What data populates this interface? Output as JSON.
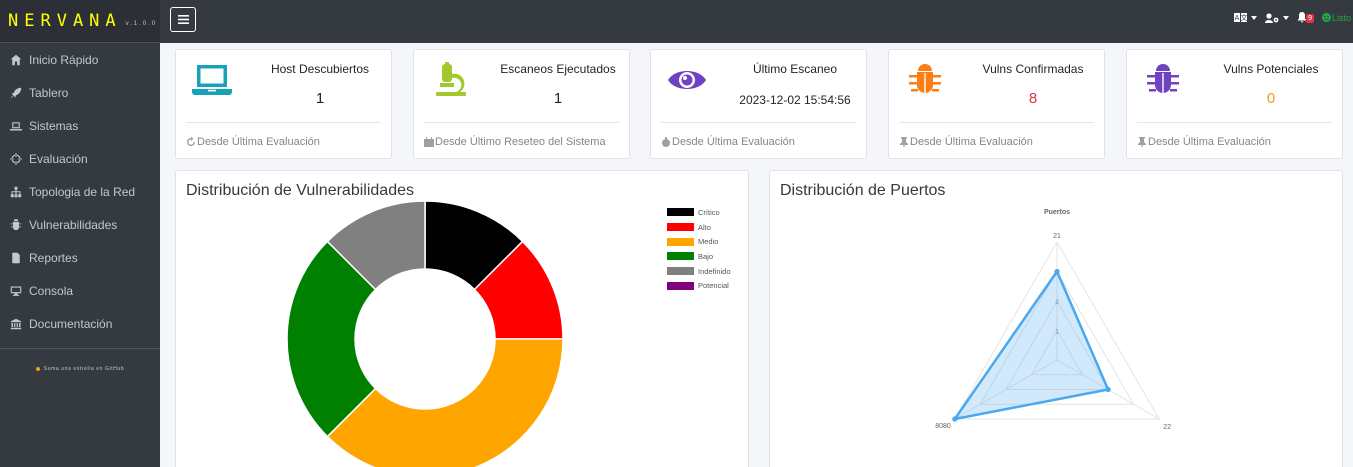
{
  "brand": {
    "name": "NERVANA",
    "version": "v.1.0.0"
  },
  "sidebar": {
    "items": [
      {
        "label": "Inicio Rápido",
        "icon": "home-icon"
      },
      {
        "label": "Tablero",
        "icon": "rocket-icon"
      },
      {
        "label": "Sistemas",
        "icon": "laptop-icon"
      },
      {
        "label": "Evaluación",
        "icon": "crosshairs-icon"
      },
      {
        "label": "Topologia de la Red",
        "icon": "sitemap-icon"
      },
      {
        "label": "Vulnerabilidades",
        "icon": "bug-icon"
      },
      {
        "label": "Reportes",
        "icon": "file-icon"
      },
      {
        "label": "Consola",
        "icon": "desktop-icon"
      },
      {
        "label": "Documentación",
        "icon": "university-icon"
      }
    ],
    "github_text": "Suma una estrella en GitHub"
  },
  "topbar": {
    "notifications_count": "9",
    "status": "Listo"
  },
  "cards": [
    {
      "title": "Host Descubiertos",
      "value": "1",
      "value_color": "#212529",
      "footer": "Desde Última Evaluación",
      "icon": "laptop-icon",
      "icon_color": "#17a2b8",
      "footer_icon": "refresh-icon"
    },
    {
      "title": "Escaneos Ejecutados",
      "value": "1",
      "value_color": "#212529",
      "footer": "Desde Último Reseteo del Sistema",
      "icon": "microscope-icon",
      "icon_color": "#a3c72e",
      "footer_icon": "calendar-icon"
    },
    {
      "title": "Último Escaneo",
      "value": "2023-12-02 15:54:56",
      "value_color": "#212529",
      "footer": "Desde Última Evaluación",
      "icon": "eye-icon",
      "icon_color": "#6f42c1",
      "footer_icon": "stopwatch-icon"
    },
    {
      "title": "Vulns Confirmadas",
      "value": "8",
      "value_color": "#dc3545",
      "footer": "Desde Última Evaluación",
      "icon": "bug-icon",
      "icon_color": "#fd7e14",
      "footer_icon": "thumbtack-icon"
    },
    {
      "title": "Vulns Potenciales",
      "value": "0",
      "value_color": "#f39c12",
      "footer": "Desde Última Evaluación",
      "icon": "bug-icon",
      "icon_color": "#6f42c1",
      "footer_icon": "thumbtack-icon"
    }
  ],
  "panels": {
    "vulns_title": "Distribución de Vulnerabilidades",
    "ports_title": "Distribución de Puertos"
  },
  "chart_data": [
    {
      "type": "pie",
      "subtype": "doughnut",
      "title": "",
      "legend_position": "top-right",
      "categories": [
        "Crítico",
        "Alto",
        "Medio",
        "Bajo",
        "Indefinido",
        "Potencial"
      ],
      "values": [
        1,
        1,
        3,
        2,
        1,
        0
      ],
      "colors": [
        "#000000",
        "#ff0000",
        "#ffa500",
        "#008000",
        "#808080",
        "#800080"
      ]
    },
    {
      "type": "radar",
      "title": "Puertos",
      "categories": [
        "21",
        "22",
        "8080"
      ],
      "series": [
        {
          "values": [
            3,
            2,
            4
          ]
        }
      ],
      "r_ticks": [
        "1",
        "2"
      ],
      "r_range": [
        0,
        4
      ],
      "color": "#4aa8f0",
      "fill": "rgba(74,168,240,0.25)"
    }
  ]
}
